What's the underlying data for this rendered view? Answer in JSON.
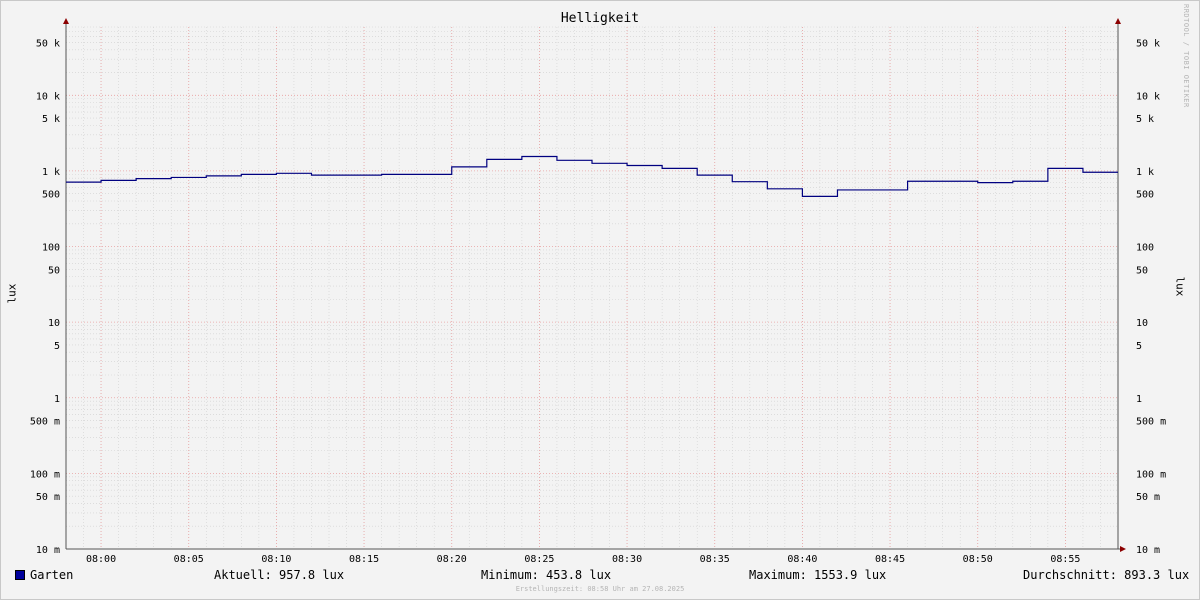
{
  "title": "Helligkeit",
  "watermark": "RRDTOOL / TOBI OETIKER",
  "footer": "Erstellungszeit: 08:58 Uhr am 27.08.2025",
  "legend": {
    "series_name": "Garten",
    "current": "Aktuell: 957.8 lux",
    "minimum": "Minimum: 453.8 lux",
    "maximum": "Maximum: 1553.9 lux",
    "average": "Durchschnitt: 893.3 lux"
  },
  "colors": {
    "line": "#000080",
    "swatch": "#00009c",
    "grid_major": "#e8a0a0",
    "grid_minor": "#d0d0d0",
    "axis_arrow": "#8b0000"
  },
  "chart_data": {
    "type": "line",
    "title": "Helligkeit",
    "ylabel": "lux",
    "yscale": "log",
    "ylim": [
      0.01,
      80000
    ],
    "xlim": [
      "07:58",
      "08:58"
    ],
    "ytick_labels": [
      "10 m",
      "50 m",
      "100 m",
      "500 m",
      "1",
      "5",
      "10",
      "50",
      "100",
      "500",
      "1 k",
      "5 k",
      "10 k",
      "50 k"
    ],
    "yticks": [
      0.01,
      0.05,
      0.1,
      0.5,
      1,
      5,
      10,
      50,
      100,
      500,
      1000,
      5000,
      10000,
      50000
    ],
    "xtick_labels": [
      "08:00",
      "08:05",
      "08:10",
      "08:15",
      "08:20",
      "08:25",
      "08:30",
      "08:35",
      "08:40",
      "08:45",
      "08:50",
      "08:55"
    ],
    "grid": true,
    "legend_position": "bottom",
    "series": [
      {
        "name": "Garten",
        "x": [
          "07:58",
          "08:00",
          "08:02",
          "08:04",
          "08:06",
          "08:08",
          "08:10",
          "08:12",
          "08:14",
          "08:16",
          "08:18",
          "08:20",
          "08:22",
          "08:24",
          "08:26",
          "08:28",
          "08:30",
          "08:32",
          "08:34",
          "08:36",
          "08:38",
          "08:40",
          "08:42",
          "08:44",
          "08:46",
          "08:48",
          "08:50",
          "08:52",
          "08:54",
          "08:56",
          "08:58"
        ],
        "values": [
          710,
          750,
          790,
          820,
          860,
          900,
          930,
          880,
          880,
          900,
          900,
          1130,
          1420,
          1550,
          1380,
          1260,
          1180,
          1080,
          880,
          720,
          580,
          460,
          560,
          560,
          730,
          730,
          700,
          730,
          1080,
          960,
          960
        ]
      }
    ]
  }
}
